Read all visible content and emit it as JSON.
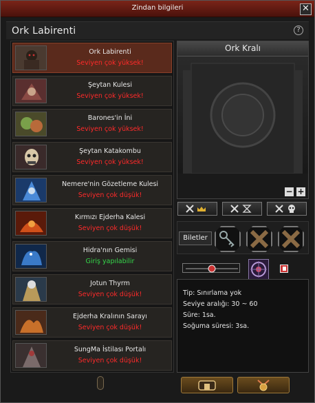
{
  "window": {
    "title": "Zindan bilgileri"
  },
  "header": {
    "dungeon_name": "Ork Labirenti"
  },
  "dungeons": [
    {
      "name": "Ork Labirenti",
      "status": "Seviyen çok yüksek!",
      "status_type": "red",
      "selected": true
    },
    {
      "name": "Şeytan Kulesi",
      "status": "Seviyen çok yüksek!",
      "status_type": "red"
    },
    {
      "name": "Barones'in İni",
      "status": "Seviyen çok yüksek!",
      "status_type": "red"
    },
    {
      "name": "Şeytan Katakombu",
      "status": "Seviyen çok yüksek!",
      "status_type": "red"
    },
    {
      "name": "Nemere'nin Gözetleme Kulesi",
      "status": "Seviyen çok düşük!",
      "status_type": "red"
    },
    {
      "name": "Kırmızı Ejderha Kalesi",
      "status": "Seviyen çok düşük!",
      "status_type": "red"
    },
    {
      "name": "Hidra'nın Gemisi",
      "status": "Giriş yapılabilir",
      "status_type": "green"
    },
    {
      "name": "Jotun Thyrm",
      "status": "Seviyen çok düşük!",
      "status_type": "red"
    },
    {
      "name": "Ejderha Kralının Sarayı",
      "status": "Seviyen çok düşük!",
      "status_type": "red"
    },
    {
      "name": "SungMa İstilası Portalı",
      "status": "Seviyen çok düşük!",
      "status_type": "red"
    }
  ],
  "boss": {
    "name": "Ork Kralı"
  },
  "tickets": {
    "label": "Biletler"
  },
  "info": {
    "type": "Tip: Sınırlama yok",
    "level_range": "Seviye aralığı: 30 ~ 60",
    "duration": "Süre: 1sa.",
    "cooldown": "Soğuma süresi: 3sa."
  },
  "colors": {
    "status_red": "#ff2a2a",
    "status_green": "#35d64a",
    "selected_bg": "#5a2a1c"
  }
}
